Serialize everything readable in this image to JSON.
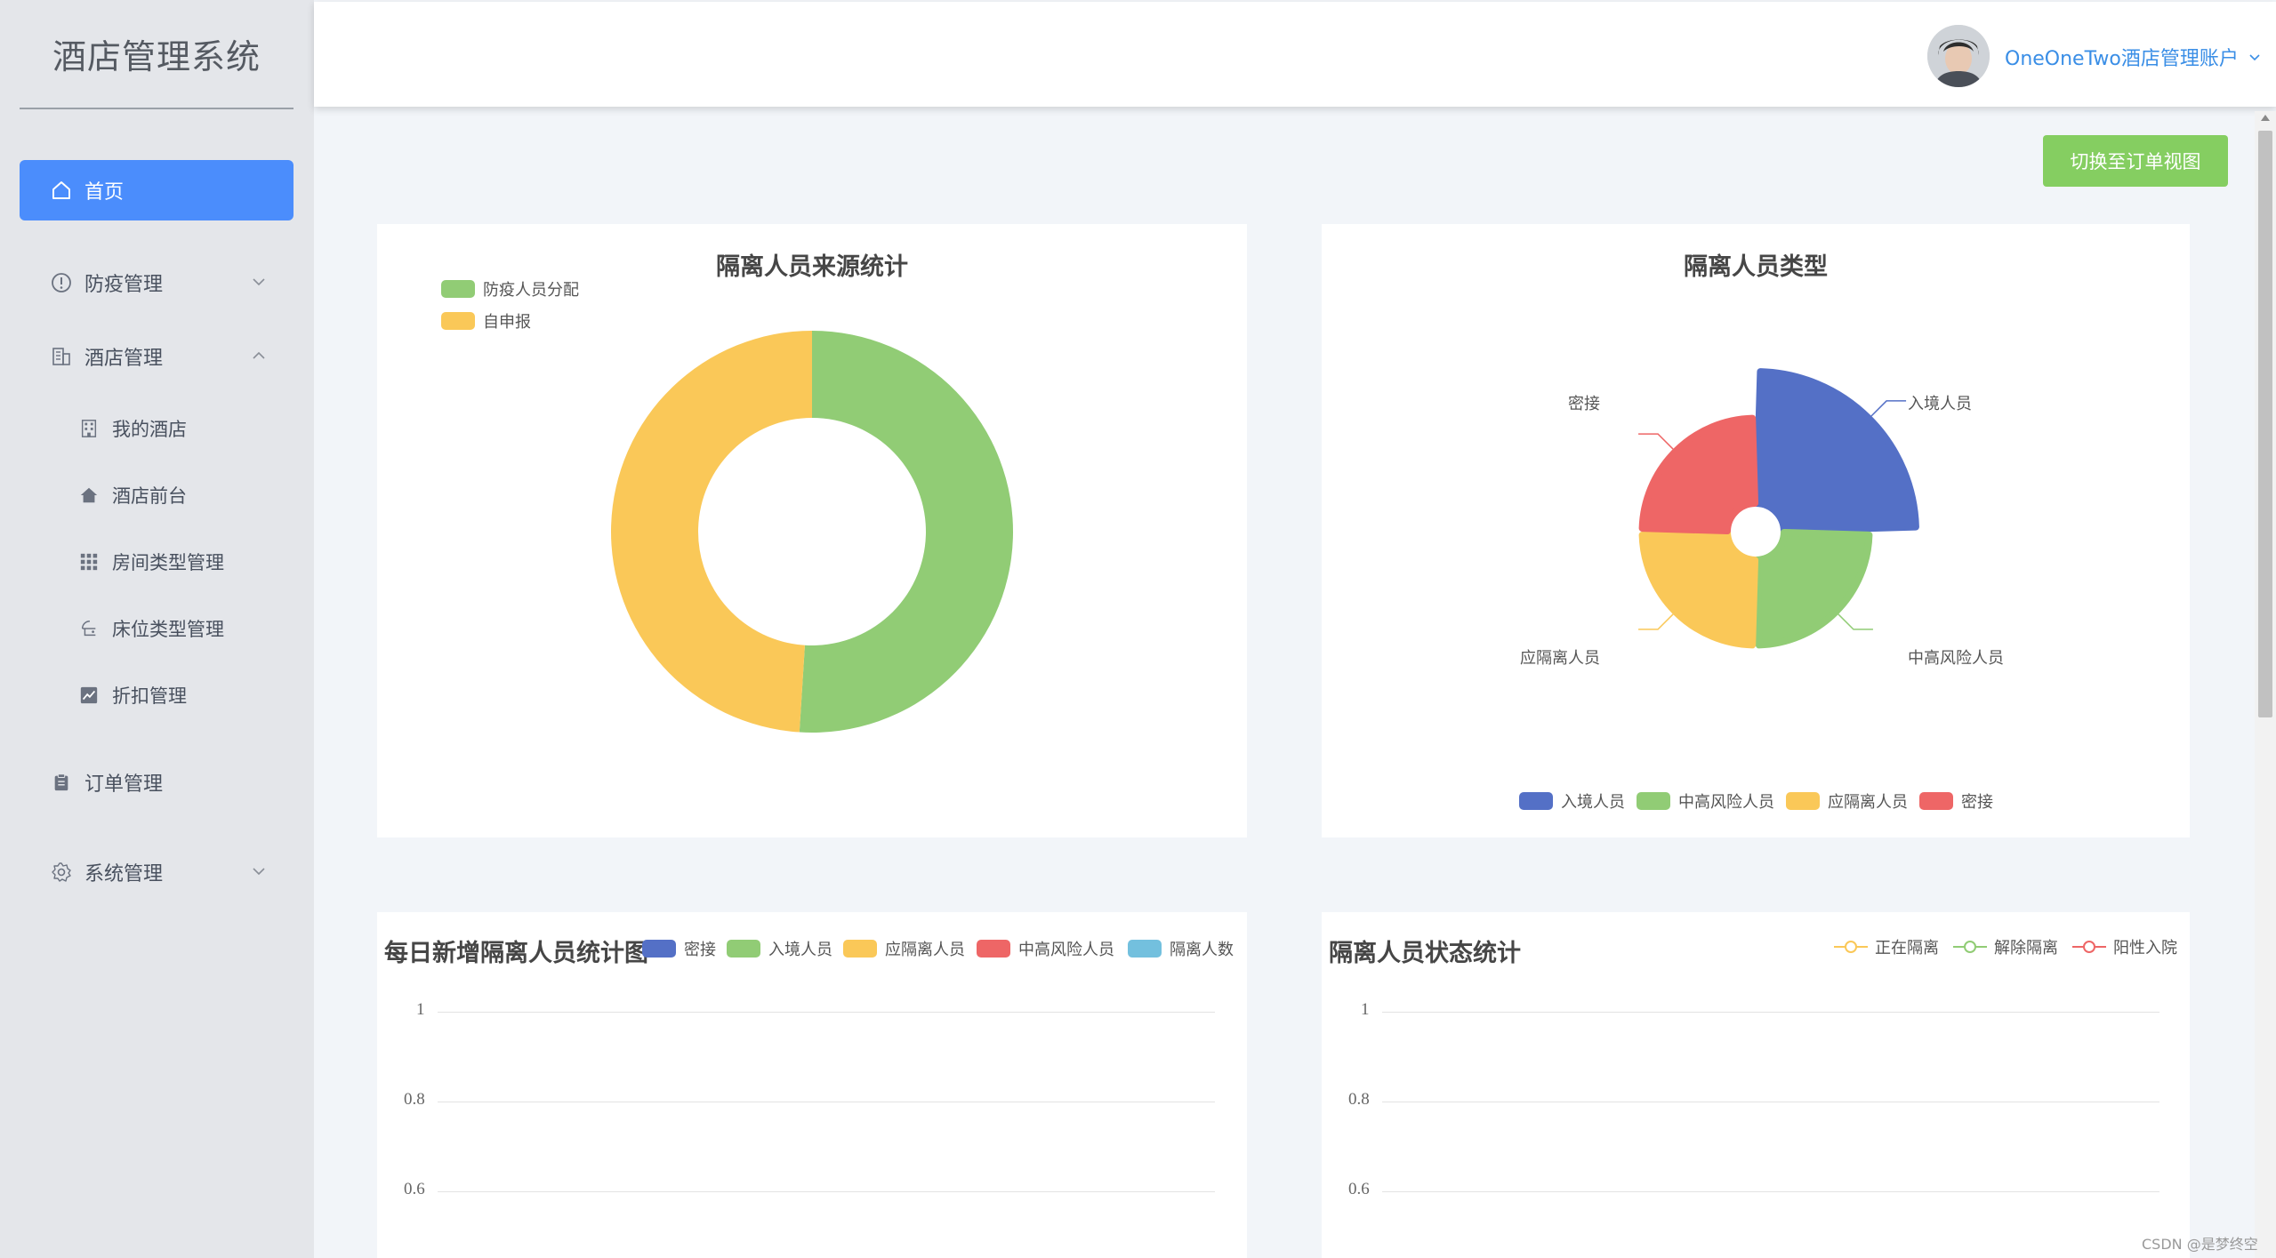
{
  "app": {
    "title": "酒店管理系统"
  },
  "sidebar": {
    "home": "首页",
    "epidemic": "防疫管理",
    "hotel": "酒店管理",
    "hotel_sub": [
      "我的酒店",
      "酒店前台",
      "房间类型管理",
      "床位类型管理",
      "折扣管理"
    ],
    "orders": "订单管理",
    "system": "系统管理"
  },
  "header": {
    "account": "OneOneTwo酒店管理账户"
  },
  "toolbar": {
    "switch_label": "切换至订单视图"
  },
  "colors": {
    "blue": "#5470c6",
    "green": "#91cc75",
    "yellow": "#fac858",
    "red": "#ee6666",
    "cyan": "#73c0de",
    "active": "#4b8dfc",
    "button": "#85ce61"
  },
  "chart_data": [
    {
      "type": "pie",
      "title": "隔离人员来源统计",
      "donut": true,
      "legend_position": "top-left",
      "slices": [
        {
          "name": "防疫人员分配",
          "value": 51,
          "color": "#91cc75"
        },
        {
          "name": "自申报",
          "value": 49,
          "color": "#fac858"
        }
      ]
    },
    {
      "type": "pie",
      "title": "隔离人员类型",
      "rose": true,
      "legend_position": "bottom",
      "slices": [
        {
          "name": "入境人员",
          "value": 4,
          "color": "#5470c6"
        },
        {
          "name": "中高风险人员",
          "value": 3,
          "color": "#91cc75"
        },
        {
          "name": "应隔离人员",
          "value": 3,
          "color": "#fac858"
        },
        {
          "name": "密接",
          "value": 3,
          "color": "#ee6666"
        }
      ]
    },
    {
      "type": "line",
      "title": "每日新增隔离人员统计图",
      "legend_position": "top-right",
      "series": [
        {
          "name": "密接",
          "color": "#5470c6",
          "values": []
        },
        {
          "name": "入境人员",
          "color": "#91cc75",
          "values": []
        },
        {
          "name": "应隔离人员",
          "color": "#fac858",
          "values": []
        },
        {
          "name": "中高风险人员",
          "color": "#ee6666",
          "values": []
        },
        {
          "name": "隔离人数",
          "color": "#73c0de",
          "values": []
        }
      ],
      "y_ticks": [
        "1",
        "0.8",
        "0.6"
      ],
      "grid": true
    },
    {
      "type": "line",
      "title": "隔离人员状态统计",
      "legend_position": "top-right",
      "series": [
        {
          "name": "正在隔离",
          "color": "#fac858",
          "values": []
        },
        {
          "name": "解除隔离",
          "color": "#91cc75",
          "values": []
        },
        {
          "name": "阳性入院",
          "color": "#ee6666",
          "values": []
        }
      ],
      "y_ticks": [
        "1",
        "0.8",
        "0.6"
      ],
      "grid": true
    }
  ],
  "watermark": "CSDN @是梦终空"
}
